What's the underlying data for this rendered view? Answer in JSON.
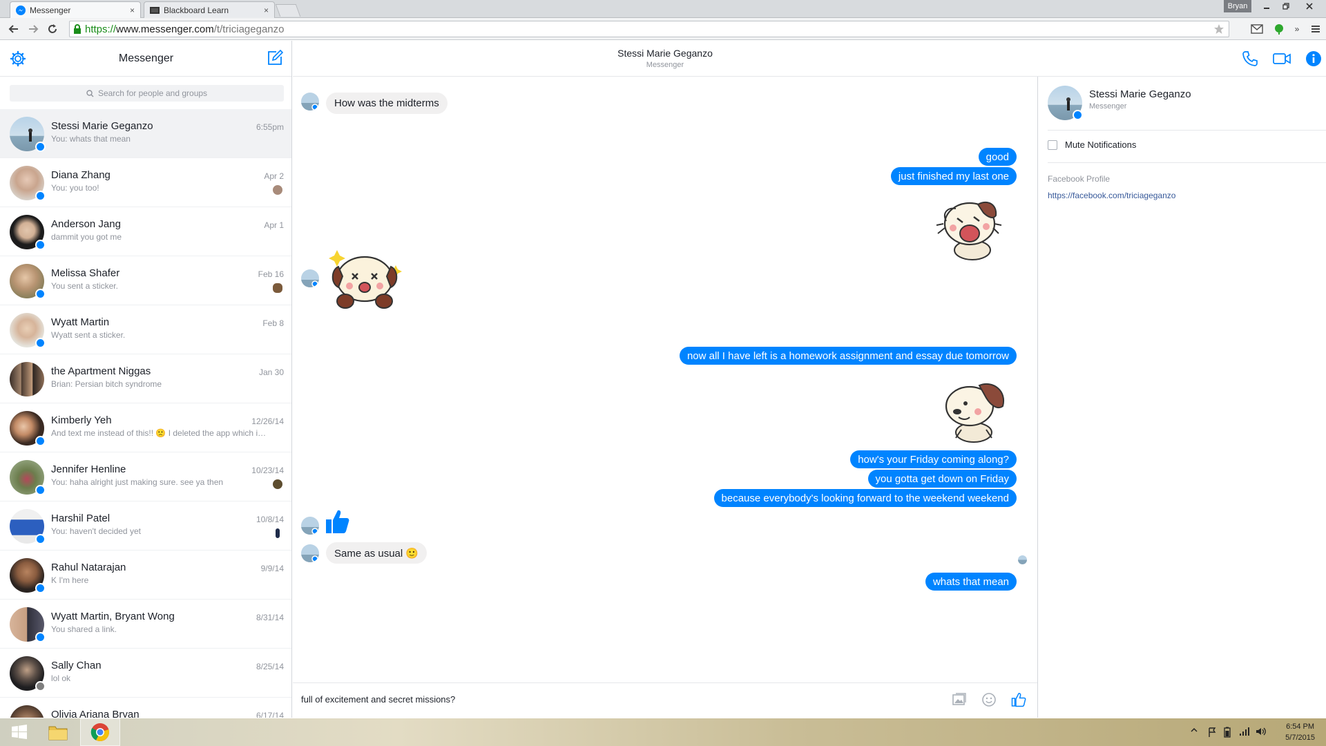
{
  "browser": {
    "tabs": [
      {
        "title": "Messenger",
        "close": "×"
      },
      {
        "title": "Blackboard Learn",
        "close": "×"
      }
    ],
    "profile_name": "Bryan",
    "url": {
      "scheme": "https://",
      "host": "www.messenger.com",
      "path": "/t/triciageganzo"
    }
  },
  "sidebar": {
    "title": "Messenger",
    "search_placeholder": "Search for people and groups",
    "conversations": [
      {
        "name": "Stessi Marie Geganzo",
        "snippet": "You: whats that mean",
        "time": "6:55pm"
      },
      {
        "name": "Diana Zhang",
        "snippet": "You: you too!",
        "time": "Apr 2"
      },
      {
        "name": "Anderson Jang",
        "snippet": "dammit you got me",
        "time": "Apr 1"
      },
      {
        "name": "Melissa Shafer",
        "snippet": "You sent a sticker.",
        "time": "Feb 16"
      },
      {
        "name": "Wyatt Martin",
        "snippet": "Wyatt sent a sticker.",
        "time": "Feb 8"
      },
      {
        "name": "the Apartment Niggas",
        "snippet": "Brian: Persian bitch syndrome",
        "time": "Jan 30"
      },
      {
        "name": "Kimberly Yeh",
        "snippet": "And text me instead of this!! 🙁 I deleted the app which i…",
        "time": "12/26/14"
      },
      {
        "name": "Jennifer Henline",
        "snippet": "You: haha alright just making sure. see ya then",
        "time": "10/23/14"
      },
      {
        "name": "Harshil Patel",
        "snippet": "You: haven't decided yet",
        "time": "10/8/14"
      },
      {
        "name": "Rahul Natarajan",
        "snippet": "K I'm here",
        "time": "9/9/14"
      },
      {
        "name": "Wyatt Martin, Bryant Wong",
        "snippet": "You shared a link.",
        "time": "8/31/14"
      },
      {
        "name": "Sally Chan",
        "snippet": "lol ok",
        "time": "8/25/14"
      },
      {
        "name": "Olivia Ariana Bryan",
        "snippet": "",
        "time": "6/17/14"
      }
    ]
  },
  "chat": {
    "contact_name": "Stessi Marie Geganzo",
    "contact_sub": "Messenger",
    "messages": {
      "in_1": "How was the midterms",
      "out_1": "good",
      "out_2": "just finished my last one",
      "out_3": "now all I have left is a homework assignment and essay due tomorrow",
      "out_4": "how's your Friday coming along?",
      "out_5": "you gotta get down on Friday",
      "out_6": "because everybody's looking forward to the weekend weekend",
      "in_2": "Same as usual 🙂",
      "out_7": "whats that mean"
    },
    "composer_text": "full of excitement and secret missions?"
  },
  "info_panel": {
    "name": "Stessi Marie Geganzo",
    "sub": "Messenger",
    "mute_label": "Mute Notifications",
    "profile_label": "Facebook Profile",
    "profile_link": "https://facebook.com/triciageganzo"
  },
  "taskbar": {
    "time": "6:54 PM",
    "date": "5/7/2015"
  },
  "colors": {
    "messenger_blue": "#0084ff",
    "incoming_bubble": "#f1f0f0",
    "link": "#365899"
  }
}
